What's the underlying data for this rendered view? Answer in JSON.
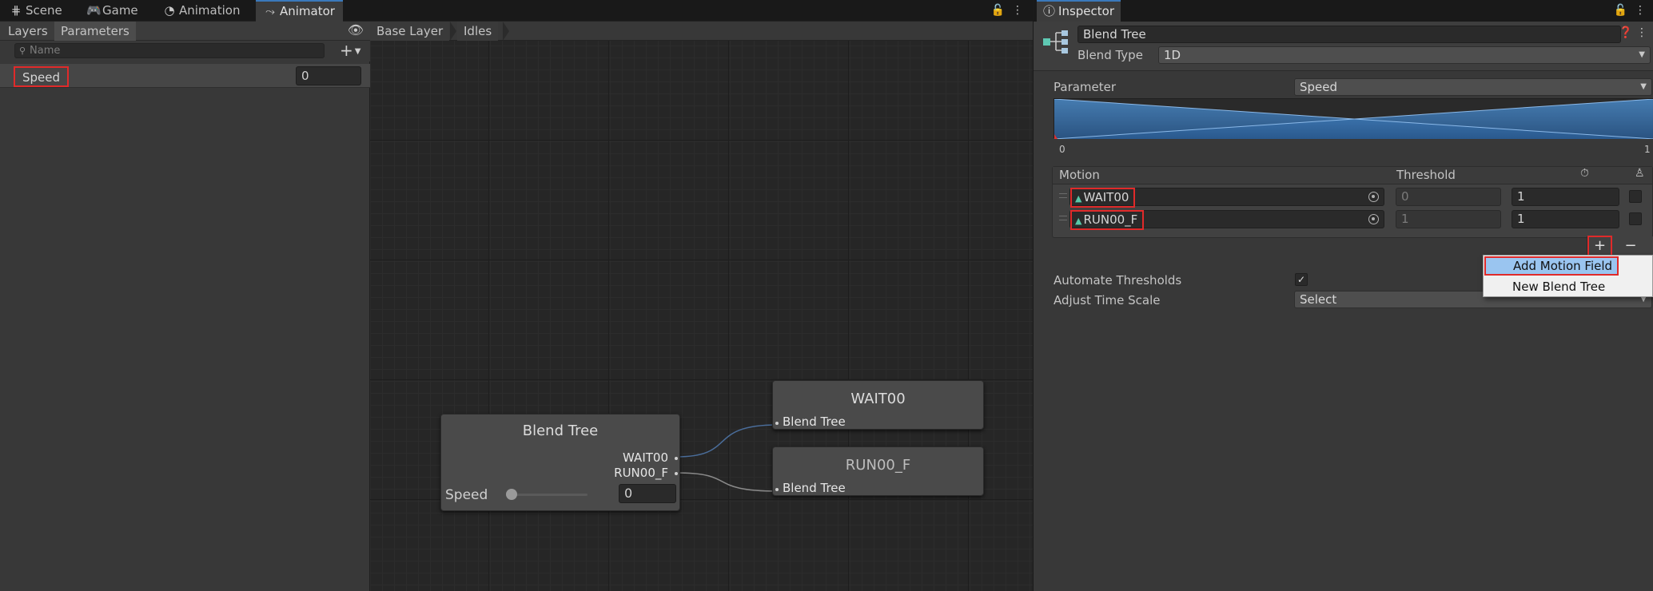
{
  "tabs": [
    {
      "label": "Scene",
      "icon": "grid-icon"
    },
    {
      "label": "Game",
      "icon": "gamepad-icon"
    },
    {
      "label": "Animation",
      "icon": "clock-icon"
    },
    {
      "label": "Animator",
      "icon": "animator-icon",
      "active": true
    }
  ],
  "left_panel": {
    "subtabs": [
      "Layers",
      "Parameters"
    ],
    "active_subtab": "Parameters",
    "search_placeholder": "Name",
    "parameters": [
      {
        "name": "Speed",
        "value": "0"
      }
    ]
  },
  "graph": {
    "breadcrumb": [
      "Base Layer",
      "Idles"
    ],
    "blend_node": {
      "title": "Blend Tree",
      "outputs": [
        "WAIT00",
        "RUN00_F"
      ],
      "param_label": "Speed",
      "param_value": "0",
      "slider_fraction": 0
    },
    "clip_nodes": [
      {
        "title": "WAIT00",
        "input_label": "Blend Tree"
      },
      {
        "title": "RUN00_F",
        "input_label": "Blend Tree"
      }
    ]
  },
  "inspector": {
    "tab_label": "Inspector",
    "name": "Blend Tree",
    "blend_type_label": "Blend Type",
    "blend_type_value": "1D",
    "parameter_label": "Parameter",
    "parameter_value": "Speed",
    "graph_min": "0",
    "graph_max": "1",
    "table_headers": {
      "motion": "Motion",
      "threshold": "Threshold"
    },
    "motions": [
      {
        "clip": "WAIT00",
        "threshold": "0",
        "time_scale": "1"
      },
      {
        "clip": "RUN00_F",
        "threshold": "1",
        "time_scale": "1"
      }
    ],
    "plus_label": "+",
    "minus_label": "−",
    "automate_label": "Automate Thresholds",
    "automate_checked": true,
    "adjust_label": "Adjust Time Scale",
    "adjust_value": "Select",
    "menu": [
      "Add Motion Field",
      "New Blend Tree"
    ]
  },
  "colors": {
    "accent": "#3a79bb",
    "highlight": "#e02a2a",
    "menu_hover": "#9ac5f0",
    "clip_icon": "#58c8a8"
  }
}
